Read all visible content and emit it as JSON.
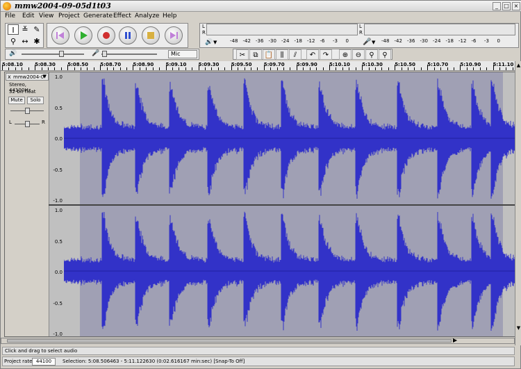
{
  "window": {
    "title": "mmw2004-09-05d1t03"
  },
  "menu": [
    "File",
    "Edit",
    "View",
    "Project",
    "Generate",
    "Effect",
    "Analyze",
    "Help"
  ],
  "transport": {
    "rewind": "skip-to-start",
    "play": "play",
    "record": "record",
    "pause": "pause",
    "stop": "stop",
    "ffwd": "skip-to-end"
  },
  "meters": {
    "play_scale": [
      "-48",
      "-42",
      "-36",
      "-30",
      "-24",
      "-18",
      "-12",
      "-6",
      "-3",
      "0"
    ],
    "rec_scale": [
      "-48",
      "-42",
      "-36",
      "-30",
      "-24",
      "-18",
      "-12",
      "-6",
      "-3",
      "0"
    ],
    "L": "L",
    "R": "R"
  },
  "mixer": {
    "input_source": "Mic"
  },
  "ruler": {
    "labels": [
      "5:08.10",
      "5:08.30",
      "5:08.50",
      "5:08.70",
      "5:08.90",
      "5:09.10",
      "5:09.30",
      "5:09.50",
      "5:09.70",
      "5:09.90",
      "5:10.10",
      "5:10.30",
      "5:10.50",
      "5:10.70",
      "5:10.90",
      "5:11.10"
    ]
  },
  "track": {
    "name": "mmw2004-0",
    "format": "Stereo, 44100Hz",
    "bits": "32-bit float",
    "mute": "Mute",
    "solo": "Solo",
    "pan_left": "L",
    "pan_right": "R",
    "close": "x",
    "y_labels": [
      "1.0",
      "0.5",
      "0.0",
      "-0.5",
      "-1.0"
    ]
  },
  "status": {
    "hint": "Click and drag to select audio",
    "rate_label": "Project rate:",
    "rate_value": "44100",
    "selection": "Selection: 5:08.506463 - 5:11.122630 (0:02.616167 min:sec)   [Snap-To Off]"
  },
  "colors": {
    "wave": "#3232c8",
    "selection": "#a0a0b4",
    "bg": "#c0c0c0"
  }
}
